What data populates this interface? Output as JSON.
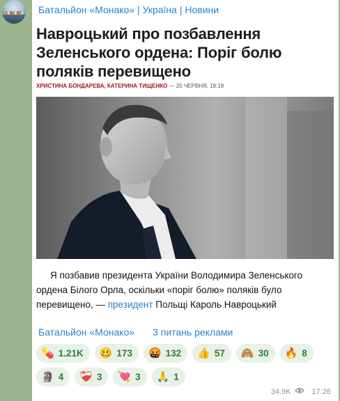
{
  "channel": {
    "name": "Батальйон «Монако» | Україна | Новини"
  },
  "article": {
    "headline": "Навроцький про позбавлення Зеленського ордена: Поріг болю поляків перевищено",
    "authors": "ХРИСТИНА БОНДАРЕВА, КАТЕРИНА ТИЩЕНКО",
    "date": " — 20 ЧЕРВНЯ, 18:18"
  },
  "body": {
    "part1": "Я позбавив президента України Володимира Зеленського ордена Білого Орла, оскільки «поріг болю» поляків було перевищено, — ",
    "link": "президент",
    "part2": " Польщі Кароль Навроцький"
  },
  "footer": {
    "link1": "Батальйон «Монако»",
    "link2": "3 питань реклами"
  },
  "reactions": [
    {
      "emoji": "💊",
      "icon": "pill-icon",
      "count": "1.21K"
    },
    {
      "emoji": "🥴",
      "icon": "woozy-face-icon",
      "count": "173"
    },
    {
      "emoji": "🤬",
      "icon": "angry-face-icon",
      "count": "132"
    },
    {
      "emoji": "👍",
      "icon": "thumbs-up-icon",
      "count": "57"
    },
    {
      "emoji": "🙈",
      "icon": "see-no-evil-monkey-icon",
      "count": "30"
    },
    {
      "emoji": "🔥",
      "icon": "fire-icon",
      "count": "8"
    },
    {
      "emoji": "🗿",
      "icon": "moai-icon",
      "count": "4"
    },
    {
      "emoji": "❤️‍🩹",
      "icon": "mending-heart-icon",
      "count": "3"
    },
    {
      "emoji": "💘",
      "icon": "heart-arrow-icon",
      "count": "3"
    },
    {
      "emoji": "🙏",
      "icon": "folded-hands-icon",
      "count": "1"
    }
  ],
  "meta": {
    "views": "34.9K",
    "time": "17:26"
  },
  "colors": {
    "link": "#2c82c5",
    "authors": "#a31621",
    "reaction_bg": "#e7f1e6",
    "reaction_text": "#2e7d3a"
  }
}
